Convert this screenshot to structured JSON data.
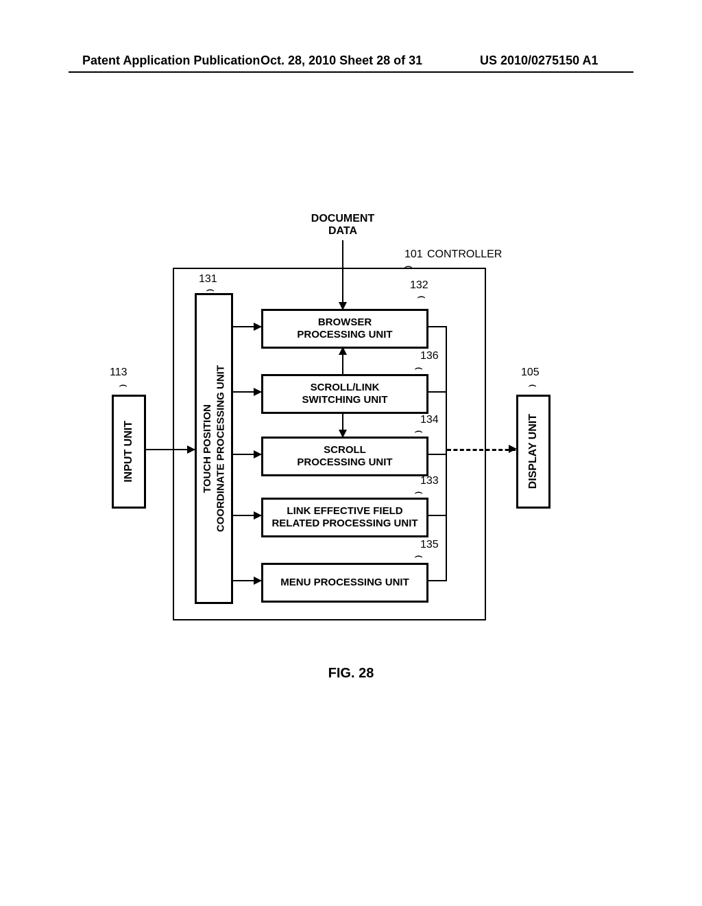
{
  "header": {
    "left": "Patent Application Publication",
    "mid": "Oct. 28, 2010  Sheet 28 of 31",
    "right": "US 2010/0275150 A1"
  },
  "labels": {
    "document_data": "DOCUMENT\nDATA",
    "controller": "CONTROLLER",
    "fig": "FIG. 28"
  },
  "refs": {
    "r101": "101",
    "r105": "105",
    "r113": "113",
    "r131": "131",
    "r132": "132",
    "r133": "133",
    "r134": "134",
    "r135": "135",
    "r136": "136"
  },
  "boxes": {
    "input_unit": "INPUT UNIT",
    "display_unit": "DISPLAY UNIT",
    "tpc_unit": "TOUCH POSITION\nCOORDINATE PROCESSING UNIT",
    "browser_unit": "BROWSER\nPROCESSING UNIT",
    "scrolllink_unit": "SCROLL/LINK\nSWITCHING UNIT",
    "scroll_unit": "SCROLL\nPROCESSING UNIT",
    "link_unit": "LINK EFFECTIVE FIELD\nRELATED PROCESSING UNIT",
    "menu_unit": "MENU PROCESSING UNIT"
  }
}
